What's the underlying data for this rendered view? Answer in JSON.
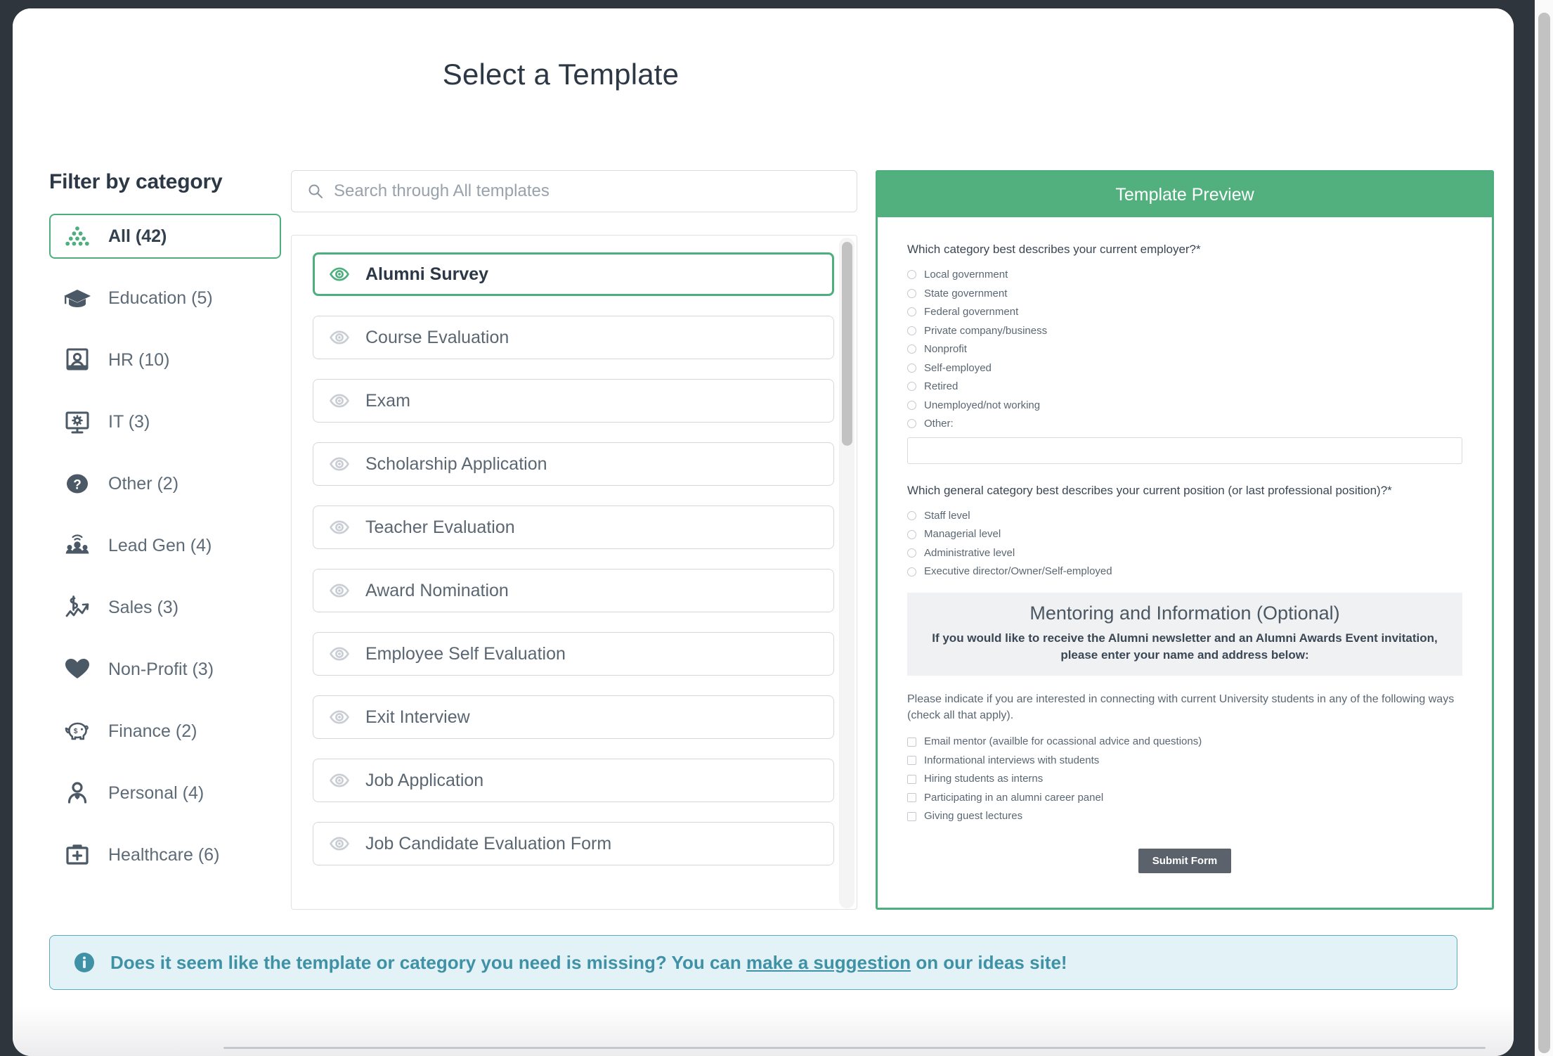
{
  "page_title": "Select a Template",
  "sidebar": {
    "title": "Filter by category",
    "items": [
      {
        "label": "All (42)",
        "icon": "dots-triangle-icon",
        "selected": true
      },
      {
        "label": "Education (5)",
        "icon": "graduation-cap-icon",
        "selected": false
      },
      {
        "label": "HR (10)",
        "icon": "id-badge-icon",
        "selected": false
      },
      {
        "label": "IT (3)",
        "icon": "monitor-gear-icon",
        "selected": false
      },
      {
        "label": "Other (2)",
        "icon": "question-circle-icon",
        "selected": false
      },
      {
        "label": "Lead Gen (4)",
        "icon": "people-signal-icon",
        "selected": false
      },
      {
        "label": "Sales (3)",
        "icon": "dollar-chart-arrow-icon",
        "selected": false
      },
      {
        "label": "Non-Profit (3)",
        "icon": "heart-icon",
        "selected": false
      },
      {
        "label": "Finance (2)",
        "icon": "piggy-bank-icon",
        "selected": false
      },
      {
        "label": "Personal (4)",
        "icon": "person-heart-icon",
        "selected": false
      },
      {
        "label": "Healthcare (6)",
        "icon": "medical-briefcase-icon",
        "selected": false
      }
    ]
  },
  "search": {
    "placeholder": "Search through All templates",
    "value": ""
  },
  "template_list": [
    {
      "label": "Alumni Survey",
      "selected": true
    },
    {
      "label": "Course Evaluation",
      "selected": false
    },
    {
      "label": "Exam",
      "selected": false
    },
    {
      "label": "Scholarship Application",
      "selected": false
    },
    {
      "label": "Teacher Evaluation",
      "selected": false
    },
    {
      "label": "Award Nomination",
      "selected": false
    },
    {
      "label": "Employee Self Evaluation",
      "selected": false
    },
    {
      "label": "Exit Interview",
      "selected": false
    },
    {
      "label": "Job Application",
      "selected": false
    },
    {
      "label": "Job Candidate Evaluation Form",
      "selected": false
    }
  ],
  "preview": {
    "header": "Template Preview",
    "question1": "Which category best describes your current employer?",
    "question1_required": "*",
    "question1_options": [
      "Local government",
      "State government",
      "Federal government",
      "Private company/business",
      "Nonprofit",
      "Self-employed",
      "Retired",
      "Unemployed/not working",
      "Other:"
    ],
    "other_value": "",
    "question2": "Which general category best describes your current position (or last professional position)?",
    "question2_required": "*",
    "question2_options": [
      "Staff level",
      "Managerial level",
      "Administrative level",
      "Executive director/Owner/Self-employed"
    ],
    "section_title": "Mentoring and Information (Optional)",
    "section_sub": "If you would like to receive the Alumni newsletter and an Alumni Awards Event invitation, please enter your name and address below:",
    "instruction": "Please indicate if you are interested in connecting with current University students in any of the following ways (check all that apply).",
    "checkbox_options": [
      "Email mentor (availble for ocassional advice and questions)",
      "Informational interviews with students",
      "Hiring students as interns",
      "Participating in an alumni career panel",
      "Giving guest lectures"
    ],
    "submit_label": "Submit Form"
  },
  "info_banner": {
    "text_before": "Does it seem like the template or category you need is missing? You can",
    "link": "make a suggestion",
    "text_after": "on our ideas site!"
  },
  "colors": {
    "accent_green": "#4caf7d",
    "header_green": "#52b07f",
    "info_teal": "#3f91a6",
    "info_bg": "#e3f2f7",
    "text_dark": "#2c3845",
    "text_muted": "#5d6b78",
    "submit_gray": "#5b626b",
    "backdrop": "#2f353c"
  }
}
